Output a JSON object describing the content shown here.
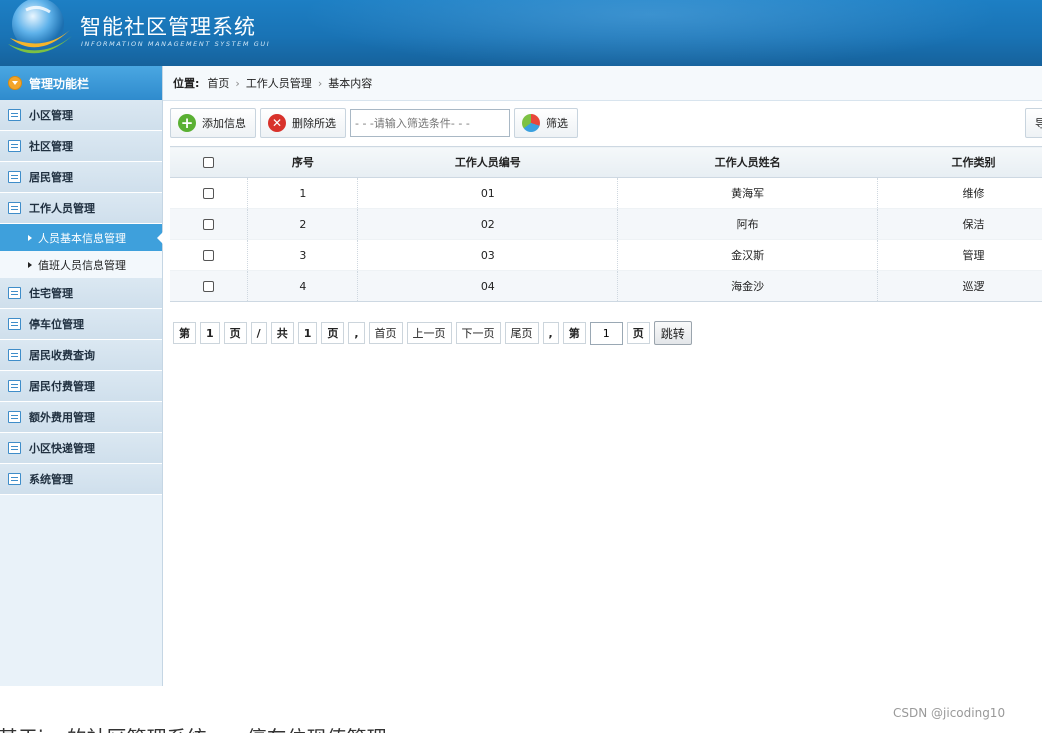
{
  "header": {
    "title": "智能社区管理系统",
    "subtitle": "INFORMATION MANAGEMENT SYSTEM GUI"
  },
  "sidebar": {
    "heading": "管理功能栏",
    "items": [
      {
        "label": "小区管理"
      },
      {
        "label": "社区管理"
      },
      {
        "label": "居民管理"
      },
      {
        "label": "工作人员管理",
        "children": [
          {
            "label": "人员基本信息管理",
            "active": true
          },
          {
            "label": "值班人员信息管理"
          }
        ]
      },
      {
        "label": "住宅管理"
      },
      {
        "label": "停车位管理"
      },
      {
        "label": "居民收费查询"
      },
      {
        "label": "居民付费管理"
      },
      {
        "label": "额外费用管理"
      },
      {
        "label": "小区快递管理"
      },
      {
        "label": "系统管理"
      }
    ]
  },
  "breadcrumb": {
    "label": "位置:",
    "items": [
      "首页",
      "工作人员管理",
      "基本内容"
    ]
  },
  "toolbar": {
    "add_label": "添加信息",
    "delete_label": "删除所选",
    "search_placeholder": "- - -请输入筛选条件- - -",
    "filter_label": "筛选",
    "right_label": "导"
  },
  "table": {
    "columns": [
      "序号",
      "工作人员编号",
      "工作人员姓名",
      "工作类别"
    ],
    "rows": [
      [
        "1",
        "01",
        "黄海军",
        "维修"
      ],
      [
        "2",
        "02",
        "阿布",
        "保洁"
      ],
      [
        "3",
        "03",
        "金汉斯",
        "管理"
      ],
      [
        "4",
        "04",
        "海金沙",
        "巡逻"
      ]
    ]
  },
  "pager": {
    "di": "第",
    "current": "1",
    "ye": "页",
    "slash": "/",
    "gong": "共",
    "total": "1",
    "comma": ",",
    "first": "首页",
    "prev": "上一页",
    "next": "下一页",
    "last": "尾页",
    "input_value": "1",
    "jump": "跳转"
  },
  "watermark": "CSDN @jicoding10",
  "caption": "基于jsp的社区管理系统——停车位现值管理"
}
